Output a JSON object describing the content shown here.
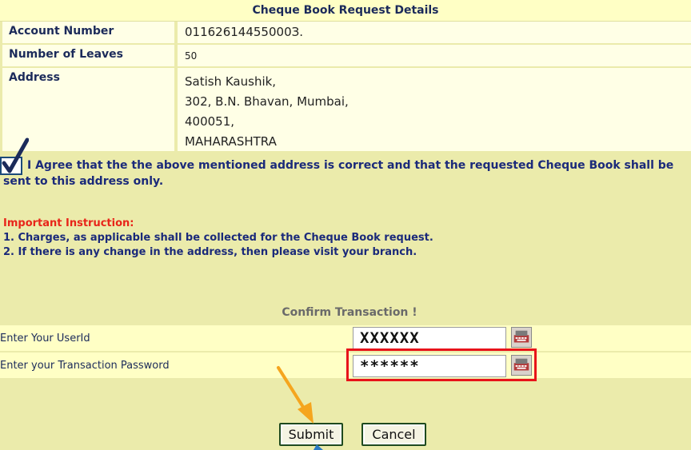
{
  "details": {
    "title": "Cheque Book Request Details",
    "account_label": "Account Number",
    "account_value": "01162614455000З.",
    "leaves_label": "Number of Leaves",
    "leaves_value": "50",
    "address_label": "Address",
    "address_lines": [
      "Satish Kaushik,",
      "302, B.N. Bhavan, Mumbai,",
      "400051,",
      "MAHARASHTRA"
    ]
  },
  "agree": {
    "checked": true,
    "text": "I Agree that the the above mentioned address is correct and that the requested Cheque Book shall be sent to this address only."
  },
  "instructions": {
    "heading": "Important Instruction:",
    "items": [
      "1. Charges, as applicable shall be collected for the Cheque Book request.",
      "2. If there is any change in the address, then please visit your branch."
    ]
  },
  "confirm": {
    "heading": "Confirm Transaction !",
    "userid_label": "Enter Your UserId",
    "userid_value": "XXXXXX",
    "password_label": "Enter your Transaction Password",
    "password_value": "******"
  },
  "buttons": {
    "submit": "Submit",
    "cancel": "Cancel"
  },
  "icons": {
    "checkbox": "checkbox-checked-icon",
    "keyboard": "virtual-keyboard-icon",
    "arrow": "annotation-arrow-icon"
  },
  "colors": {
    "background": "#ebebab",
    "header": "#ffffc5",
    "instruction_heading": "#e8251a",
    "highlight": "#e8131a",
    "arrow": "#f5a51e"
  }
}
